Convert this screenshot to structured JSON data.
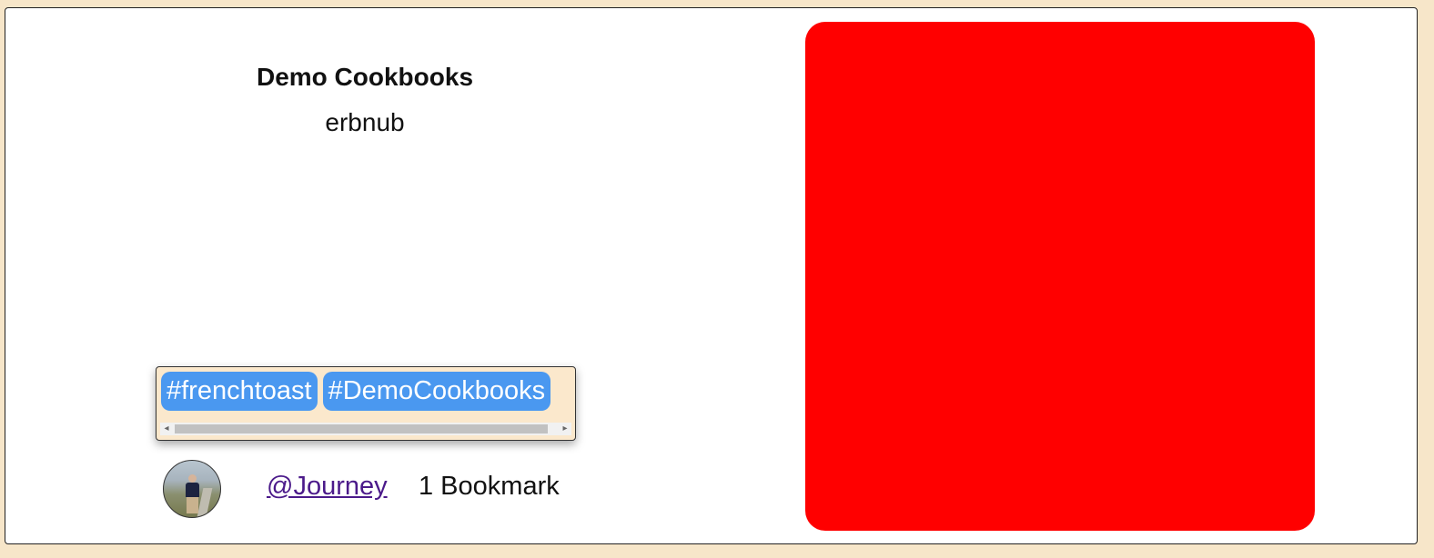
{
  "card": {
    "title": "Demo Cookbooks",
    "subtitle": "erbnub",
    "tags": [
      "#frenchtoast",
      "#DemoCookbooks"
    ],
    "user_handle": "@Journey",
    "bookmark_text": "1 Bookmark",
    "image_color": "#ff0000"
  },
  "colors": {
    "tag_background": "#4a98f0",
    "link": "#4b1a8a",
    "page_background": "#f7e6c9"
  },
  "icons": {
    "scroll_left": "scroll-left-arrow-icon",
    "scroll_right": "scroll-right-arrow-icon"
  }
}
